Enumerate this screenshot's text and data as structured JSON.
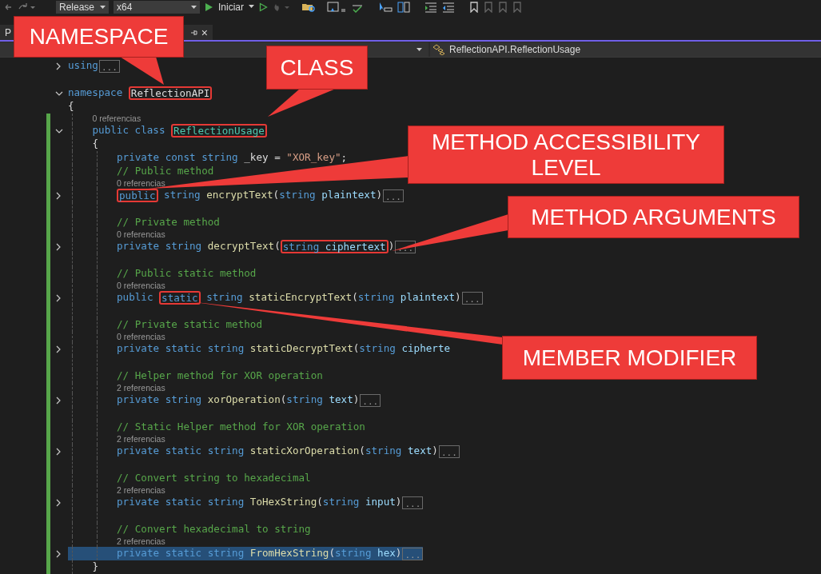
{
  "toolbar": {
    "configuration": "Release",
    "platform": "x64",
    "start": "Iniciar"
  },
  "tab": {
    "label": "P",
    "close": "×"
  },
  "navbar": {
    "member": "ReflectionAPI.ReflectionUsage"
  },
  "editor": {
    "lines": [
      {
        "kind": "code",
        "expanded": false,
        "selected": false,
        "changed": false,
        "ellipsis": "...",
        "tokens": [
          {
            "kind": "keyword",
            "t": "using"
          }
        ]
      },
      {
        "kind": "blank"
      },
      {
        "kind": "code",
        "expanded": true,
        "selected": false,
        "changed": false,
        "tokens": [
          {
            "kind": "keyword",
            "t": "namespace "
          },
          {
            "kind": "plain",
            "t": "ReflectionAPI",
            "highlight": true
          }
        ]
      },
      {
        "kind": "code",
        "selected": false,
        "changed": false,
        "tokens": [
          {
            "kind": "plain",
            "t": "{"
          }
        ]
      },
      {
        "kind": "block",
        "children": [
          {
            "kind": "refs",
            "changed": true,
            "text": "0 referencias"
          },
          {
            "kind": "code",
            "expanded": true,
            "selected": false,
            "changed": true,
            "tokens": [
              {
                "kind": "keyword",
                "t": "public class "
              },
              {
                "kind": "type",
                "t": "ReflectionUsage",
                "highlight": true
              }
            ]
          },
          {
            "kind": "code",
            "selected": false,
            "changed": true,
            "tokens": [
              {
                "kind": "plain",
                "t": "{"
              }
            ]
          },
          {
            "kind": "block",
            "children": [
              {
                "kind": "code",
                "selected": false,
                "changed": true,
                "tokens": [
                  {
                    "kind": "keyword",
                    "t": "private const string "
                  },
                  {
                    "kind": "plain",
                    "t": "_key = "
                  },
                  {
                    "kind": "string",
                    "t": "\"XOR_key\""
                  },
                  {
                    "kind": "plain",
                    "t": ";"
                  }
                ]
              },
              {
                "kind": "comment",
                "changed": true,
                "text": "// Public method"
              },
              {
                "kind": "refs",
                "changed": true,
                "text": "0 referencias"
              },
              {
                "kind": "code",
                "expanded": false,
                "selected": false,
                "changed": true,
                "ellipsis": "...",
                "tokens": [
                  {
                    "kind": "keyword",
                    "t": "public",
                    "highlight": true
                  },
                  {
                    "kind": "keyword",
                    "t": " string "
                  },
                  {
                    "kind": "method",
                    "t": "encryptText"
                  },
                  {
                    "kind": "plain",
                    "t": "("
                  },
                  {
                    "kind": "keyword",
                    "t": "string "
                  },
                  {
                    "kind": "parameter",
                    "t": "plaintext"
                  },
                  {
                    "kind": "plain",
                    "t": ")"
                  }
                ]
              },
              {
                "kind": "blank",
                "changed": true
              },
              {
                "kind": "comment",
                "changed": true,
                "text": "// Private method"
              },
              {
                "kind": "refs",
                "changed": true,
                "text": "0 referencias"
              },
              {
                "kind": "code",
                "expanded": false,
                "selected": false,
                "changed": true,
                "ellipsis": "...",
                "tokens": [
                  {
                    "kind": "keyword",
                    "t": "private string "
                  },
                  {
                    "kind": "method",
                    "t": "decryptText"
                  },
                  {
                    "kind": "plain",
                    "t": "("
                  },
                  {
                    "kind": "keyword",
                    "t": "string ",
                    "highlight": true
                  },
                  {
                    "kind": "parameter",
                    "t": "ciphertext",
                    "highlight": true
                  },
                  {
                    "kind": "plain",
                    "t": ")"
                  }
                ]
              },
              {
                "kind": "blank",
                "changed": true
              },
              {
                "kind": "comment",
                "changed": true,
                "text": "// Public static method"
              },
              {
                "kind": "refs",
                "changed": true,
                "text": "0 referencias"
              },
              {
                "kind": "code",
                "expanded": false,
                "selected": false,
                "changed": true,
                "ellipsis": "...",
                "tokens": [
                  {
                    "kind": "keyword",
                    "t": "public "
                  },
                  {
                    "kind": "keyword",
                    "t": "static",
                    "highlight": true
                  },
                  {
                    "kind": "keyword",
                    "t": " string "
                  },
                  {
                    "kind": "method",
                    "t": "staticEncryptText"
                  },
                  {
                    "kind": "plain",
                    "t": "("
                  },
                  {
                    "kind": "keyword",
                    "t": "string "
                  },
                  {
                    "kind": "parameter",
                    "t": "plaintext"
                  },
                  {
                    "kind": "plain",
                    "t": ")"
                  }
                ]
              },
              {
                "kind": "blank",
                "changed": true
              },
              {
                "kind": "comment",
                "changed": true,
                "text": "// Private static method"
              },
              {
                "kind": "refs",
                "changed": true,
                "text": "0 referencias"
              },
              {
                "kind": "code",
                "expanded": false,
                "selected": false,
                "changed": true,
                "tokens": [
                  {
                    "kind": "keyword",
                    "t": "private static string "
                  },
                  {
                    "kind": "method",
                    "t": "staticDecryptText"
                  },
                  {
                    "kind": "plain",
                    "t": "("
                  },
                  {
                    "kind": "keyword",
                    "t": "string "
                  },
                  {
                    "kind": "parameter",
                    "t": "cipherte"
                  }
                ]
              },
              {
                "kind": "blank",
                "changed": true
              },
              {
                "kind": "comment",
                "changed": true,
                "text": "// Helper method for XOR operation"
              },
              {
                "kind": "refs",
                "changed": true,
                "text": "2 referencias"
              },
              {
                "kind": "code",
                "expanded": false,
                "selected": false,
                "changed": true,
                "ellipsis": "...",
                "tokens": [
                  {
                    "kind": "keyword",
                    "t": "private string "
                  },
                  {
                    "kind": "method",
                    "t": "xorOperation"
                  },
                  {
                    "kind": "plain",
                    "t": "("
                  },
                  {
                    "kind": "keyword",
                    "t": "string "
                  },
                  {
                    "kind": "parameter",
                    "t": "text"
                  },
                  {
                    "kind": "plain",
                    "t": ")"
                  }
                ]
              },
              {
                "kind": "blank",
                "changed": true
              },
              {
                "kind": "comment",
                "changed": true,
                "text": "// Static Helper method for XOR operation"
              },
              {
                "kind": "refs",
                "changed": true,
                "text": "2 referencias"
              },
              {
                "kind": "code",
                "expanded": false,
                "selected": false,
                "changed": true,
                "ellipsis": "...",
                "tokens": [
                  {
                    "kind": "keyword",
                    "t": "private static string "
                  },
                  {
                    "kind": "method",
                    "t": "staticXorOperation"
                  },
                  {
                    "kind": "plain",
                    "t": "("
                  },
                  {
                    "kind": "keyword",
                    "t": "string "
                  },
                  {
                    "kind": "parameter",
                    "t": "text"
                  },
                  {
                    "kind": "plain",
                    "t": ")"
                  }
                ]
              },
              {
                "kind": "blank",
                "changed": true
              },
              {
                "kind": "comment",
                "changed": true,
                "text": "// Convert string to hexadecimal"
              },
              {
                "kind": "refs",
                "changed": true,
                "text": "2 referencias"
              },
              {
                "kind": "code",
                "expanded": false,
                "selected": false,
                "changed": true,
                "ellipsis": "...",
                "tokens": [
                  {
                    "kind": "keyword",
                    "t": "private static string "
                  },
                  {
                    "kind": "method",
                    "t": "ToHexString"
                  },
                  {
                    "kind": "plain",
                    "t": "("
                  },
                  {
                    "kind": "keyword",
                    "t": "string "
                  },
                  {
                    "kind": "parameter",
                    "t": "input"
                  },
                  {
                    "kind": "plain",
                    "t": ")"
                  }
                ]
              },
              {
                "kind": "blank",
                "changed": true
              },
              {
                "kind": "comment",
                "changed": true,
                "text": "// Convert hexadecimal to string"
              },
              {
                "kind": "refs",
                "changed": true,
                "text": "2 referencias"
              },
              {
                "kind": "code",
                "expanded": false,
                "selected": true,
                "changed": true,
                "ellipsis": "...",
                "tokens": [
                  {
                    "kind": "keyword",
                    "t": "private static string "
                  },
                  {
                    "kind": "method",
                    "t": "FromHexString"
                  },
                  {
                    "kind": "plain",
                    "t": "("
                  },
                  {
                    "kind": "keyword",
                    "t": "string "
                  },
                  {
                    "kind": "parameter",
                    "t": "hex"
                  },
                  {
                    "kind": "plain",
                    "t": ")"
                  }
                ]
              }
            ]
          },
          {
            "kind": "code",
            "selected": false,
            "changed": true,
            "tokens": [
              {
                "kind": "plain",
                "t": "}"
              }
            ]
          }
        ]
      }
    ]
  },
  "annotations": [
    {
      "text": "NAMESPACE"
    },
    {
      "text": "CLASS"
    },
    {
      "text": "METHOD ACCESSIBILITY LEVEL"
    },
    {
      "text": "METHOD ARGUMENTS"
    },
    {
      "text": "MEMBER MODIFIER"
    }
  ]
}
